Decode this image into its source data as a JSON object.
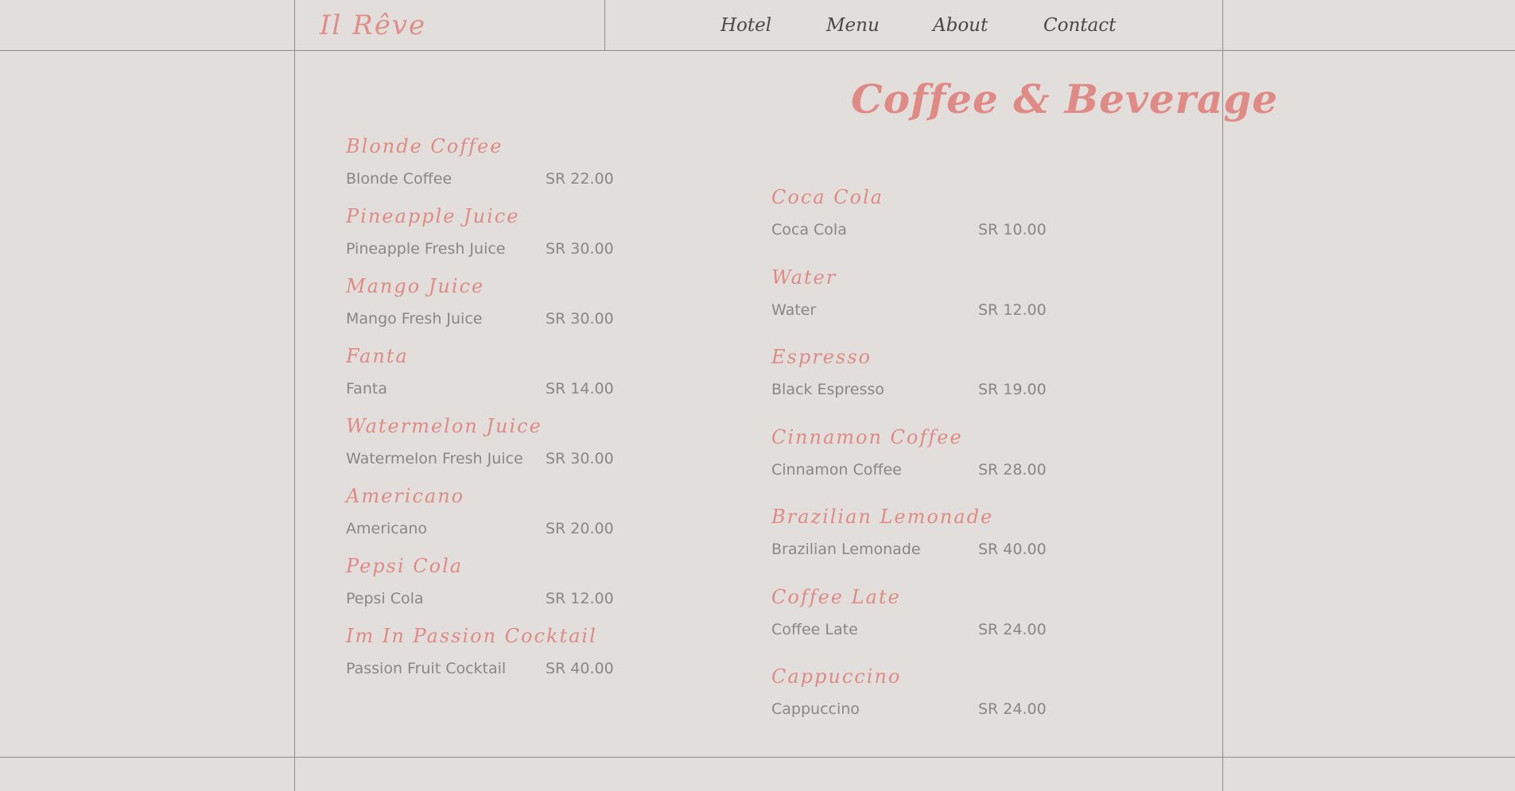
{
  "header": {
    "logo": "Il Rêve",
    "nav": [
      {
        "label": "Hotel"
      },
      {
        "label": "Menu"
      },
      {
        "label": "About"
      },
      {
        "label": "Contact"
      }
    ]
  },
  "page": {
    "title": "Coffee & Beverage"
  },
  "menu": {
    "left": [
      {
        "category": "Blonde Coffee",
        "item": "Blonde Coffee",
        "price": "SR 22.00"
      },
      {
        "category": "Pineapple Juice",
        "item": "Pineapple Fresh Juice",
        "price": "SR 30.00"
      },
      {
        "category": "Mango Juice",
        "item": "Mango Fresh Juice",
        "price": "SR 30.00"
      },
      {
        "category": "Fanta",
        "item": "Fanta",
        "price": "SR 14.00"
      },
      {
        "category": "Watermelon Juice",
        "item": "Watermelon Fresh Juice",
        "price": "SR 30.00"
      },
      {
        "category": "Americano",
        "item": "Americano",
        "price": "SR 20.00"
      },
      {
        "category": "Pepsi Cola",
        "item": "Pepsi Cola",
        "price": "SR 12.00"
      },
      {
        "category": "Im In Passion Cocktail",
        "item": "Passion Fruit Cocktail",
        "price": "SR 40.00"
      }
    ],
    "right": [
      {
        "category": "Coca Cola",
        "item": "Coca Cola",
        "price": "SR 10.00"
      },
      {
        "category": "Water",
        "item": "Water",
        "price": "SR 12.00"
      },
      {
        "category": "Espresso",
        "item": "Black Espresso",
        "price": "SR 19.00"
      },
      {
        "category": "Cinnamon Coffee",
        "item": "Cinnamon Coffee",
        "price": "SR 28.00"
      },
      {
        "category": "Brazilian Lemonade",
        "item": "Brazilian Lemonade",
        "price": "SR 40.00"
      },
      {
        "category": "Coffee Late",
        "item": "Coffee Late",
        "price": "SR 24.00"
      },
      {
        "category": "Cappuccino",
        "item": "Cappuccino",
        "price": "SR 24.00"
      }
    ]
  },
  "colors": {
    "background": "#e2dedb",
    "accent": "#e08a86",
    "nav_text": "#4b4746",
    "body_text": "#8a8684",
    "rule": "#8e8a88"
  }
}
